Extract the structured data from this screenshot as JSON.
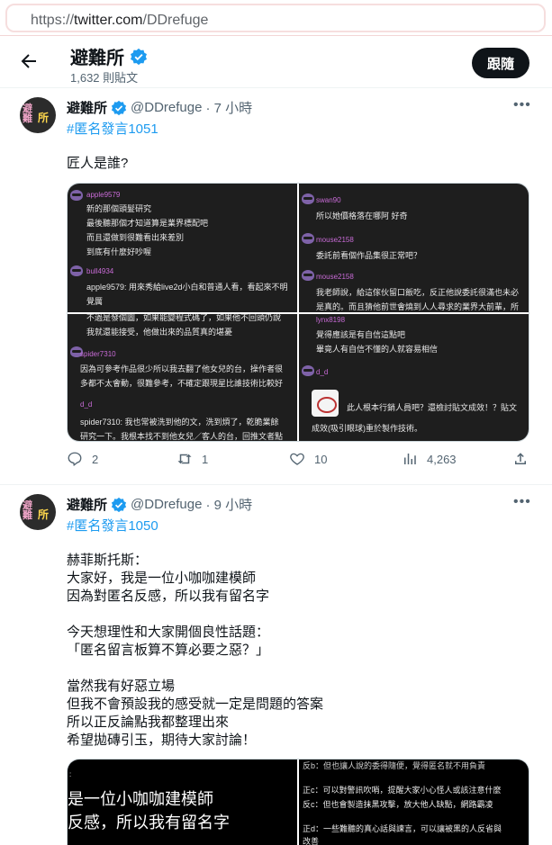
{
  "browser": {
    "url_scheme": "https://",
    "url_host": "twitter.com",
    "url_path": "/DDrefuge"
  },
  "header": {
    "title": "避難所",
    "post_count": "1,632 則貼文",
    "follow_label": "跟隨"
  },
  "tweets": [
    {
      "name": "避難所",
      "handle": "@DDrefuge",
      "time": "· 7 小時",
      "hashtag": "#匿名發言1051",
      "text": "匠人是誰?",
      "stats": {
        "replies": "2",
        "retweets": "1",
        "likes": "10",
        "views": "4,263"
      },
      "media": {
        "tl": [
          {
            "type": "un",
            "t": "apple9579"
          },
          {
            "type": "tx",
            "t": "新的那個頭髮研究"
          },
          {
            "type": "tx",
            "t": "最後聽那個才知道算是業界標配吧"
          },
          {
            "type": "tx",
            "t": "而且還做到很難看出來差別"
          },
          {
            "type": "tx",
            "t": "到底有什麼好吵喔"
          },
          {
            "type": "un",
            "t": "bull4934"
          },
          {
            "type": "tx",
            "t": "apple9579: 用來秀給live2d小白和普通人看，看起來不明"
          },
          {
            "type": "tx",
            "t": "覺厲"
          }
        ],
        "bl": [
          {
            "type": "tx",
            "t": "不過是發個圖，如果能變程式碼了，如果他不回頭仍說"
          },
          {
            "type": "tx",
            "t": "我就還能接受，他做出來的品質真的堪憂"
          },
          {
            "type": "un",
            "t": "spider7310"
          },
          {
            "type": "tx",
            "t": "因為可參考作品很少所以我去翻了他女兒的台，操作者很"
          },
          {
            "type": "tx",
            "t": "多都不太會動，很難參考，不確定跟現星比誰技術比較好"
          },
          {
            "type": "un",
            "t": "d_d"
          },
          {
            "type": "tx",
            "t": "spider7310: 我也常被洗到他的文，洗到煩了，乾脆業餘"
          },
          {
            "type": "tx",
            "t": "研究一下。我根本找不到他女兒／客人的台，回推文者點"
          }
        ],
        "tr": [
          {
            "type": "un",
            "t": "swan90"
          },
          {
            "type": "tx",
            "t": "所以她價格落在哪阿 好奇"
          },
          {
            "type": "un",
            "t": "mouse2158"
          },
          {
            "type": "tx",
            "t": "委託前看個作品集很正常吧？"
          },
          {
            "type": "un",
            "t": "mouse2158"
          },
          {
            "type": "tx",
            "t": "我老師說，給這傢伙留口飯吃，反正他說委託很滿也未必"
          },
          {
            "type": "tx",
            "t": "是真的。而且猜他前世會燒到人人尋求的業界大前輩，所"
          }
        ],
        "br": [
          {
            "type": "un",
            "t": "lynx8198"
          },
          {
            "type": "tx",
            "t": "覺得應該是有自信這點吧"
          },
          {
            "type": "tx",
            "t": "畢竟人有自信不懂的人就容易相信"
          },
          {
            "type": "un",
            "t": "d_d"
          },
          {
            "type": "tx",
            "t": "此人根本行銷人員吧？還檢討貼文成效！？貼文"
          },
          {
            "type": "tx",
            "t": "成效(吸引眼球)重於製作技術。"
          }
        ]
      }
    },
    {
      "name": "避難所",
      "handle": "@DDrefuge",
      "time": "· 9 小時",
      "hashtag": "#匿名發言1050",
      "text_lines": [
        "赫菲斯托斯：",
        "大家好，我是一位小咖咖建模師",
        "因為對匿名反感，所以我有留名字",
        "",
        "今天想理性和大家開個良性話題：",
        "「匿名留言板算不算必要之惡？」",
        "",
        "當然我有好惡立場",
        "但我不會預設我的感受就一定是問題的答案",
        "所以正反論點我都整理出來",
        "希望拋磚引玉，期待大家討論！"
      ],
      "media": {
        "left_lines": [
          "是一位小咖咖建模師",
          "反感，所以我有留名字"
        ],
        "right_lines": [
          "反b：但也讓人說的委得隨便，覺得匿名就不用負責",
          "正c：可以對警訊吹哨，提醒大家小心怪人或該注意什麼",
          "反c：但也會製造抹黑攻擊，放大他人缺點，網路霸凌",
          "正d：一些難聽的真心話與諫言，可以讓被黑的人反省與",
          "改善"
        ]
      }
    }
  ],
  "colors": {
    "accent": "#1d9bf0",
    "verified": "#1d9bf0",
    "username_purple": "#c86bd6",
    "follow_bg": "#0f1419"
  }
}
